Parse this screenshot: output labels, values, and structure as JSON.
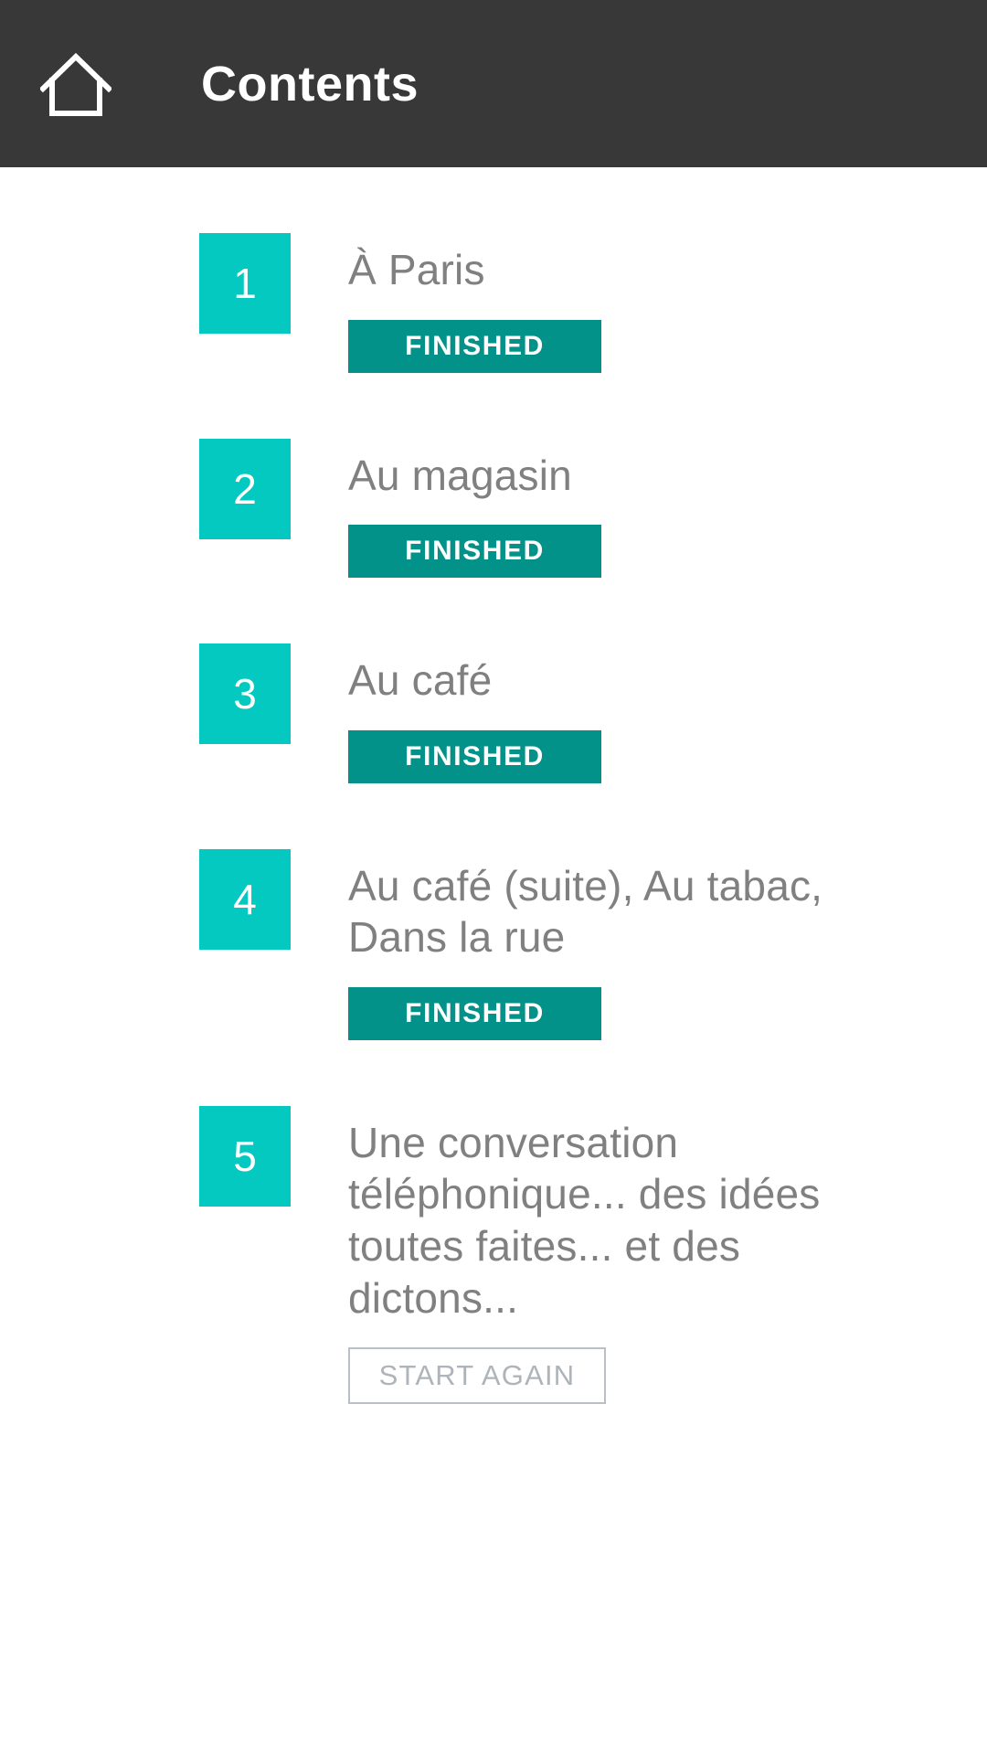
{
  "header": {
    "title": "Contents",
    "home_icon": "home-icon",
    "background_color": "#383838",
    "text_color": "#ffffff"
  },
  "theme": {
    "badge_color": "#04c9c1",
    "finished_color": "#029289",
    "title_text_color": "#808080",
    "outline_button_border": "#b9bfc4",
    "outline_button_text": "#aeb4b9",
    "page_background": "#ffffff"
  },
  "contents": {
    "items": [
      {
        "number": "1",
        "title": "À Paris",
        "status": "FINISHED",
        "status_type": "finished"
      },
      {
        "number": "2",
        "title": "Au magasin",
        "status": "FINISHED",
        "status_type": "finished"
      },
      {
        "number": "3",
        "title": "Au café",
        "status": "FINISHED",
        "status_type": "finished"
      },
      {
        "number": "4",
        "title": "Au café (suite), Au tabac, Dans la rue",
        "status": "FINISHED",
        "status_type": "finished"
      },
      {
        "number": "5",
        "title": "Une conversation téléphonique... des idées toutes faites... et des dictons...",
        "status": "START AGAIN",
        "status_type": "start_again"
      }
    ]
  }
}
